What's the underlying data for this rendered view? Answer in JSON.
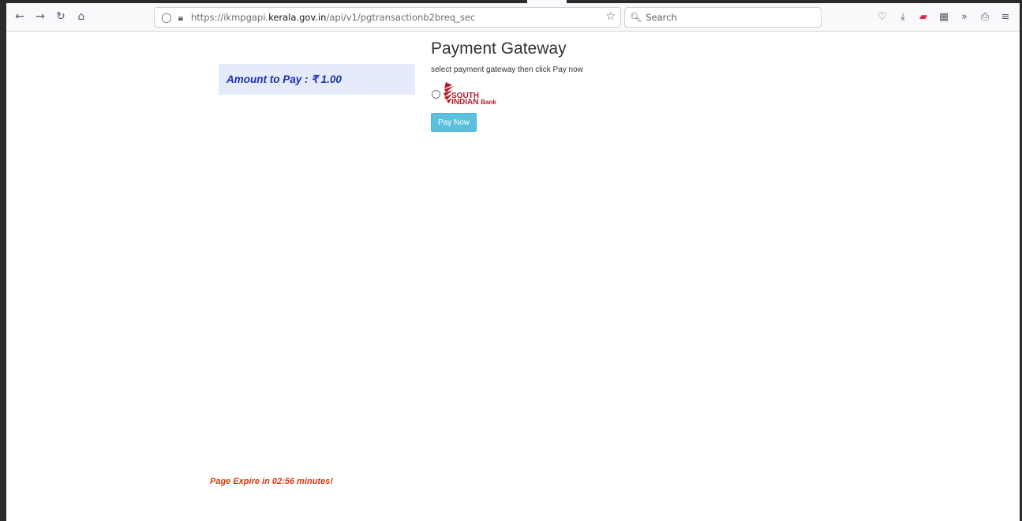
{
  "browser": {
    "url_prefix": "https://ikmpgapi.",
    "url_domain": "kerala.gov.in",
    "url_path": "/api/v1/pgtransactionb2breq_sec",
    "search_placeholder": "Search",
    "icons": [
      "back-icon",
      "forward-icon",
      "reload-icon",
      "home-icon",
      "shield-icon",
      "lock-icon",
      "bookmark-star-icon",
      "search-icon",
      "pocket-icon",
      "download-icon",
      "extension-icon",
      "screenshot-icon",
      "overflow-icon",
      "account-icon",
      "menu-icon"
    ]
  },
  "amount": {
    "label": "Amount to Pay : ₹ 1.00"
  },
  "gateway": {
    "title": "Payment Gateway",
    "subtitle": "select payment gateway then click Pay now",
    "bank_line1": "SOUTH",
    "bank_line2": "INDIAN",
    "bank_line3": "Bank",
    "pay_label": "Pay Now"
  },
  "expiry": {
    "text": "Page Expire in 02:56 minutes!"
  },
  "colors": {
    "amount_text": "#1b2fb5",
    "amount_bg": "#e5ebfb",
    "button": "#5bc0de",
    "expiry_text": "#e0340b",
    "bank_red": "#b11d2b"
  }
}
